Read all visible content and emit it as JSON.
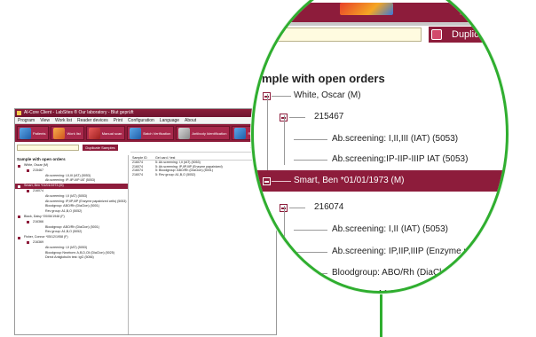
{
  "small_app": {
    "title": "Al-Core Client - LabSites ® Our laboratory - Blut geprüft",
    "menu": [
      "Program",
      "View",
      "Work list",
      "Reader devices",
      "Print",
      "Configuration",
      "Language",
      "About"
    ],
    "toolbar": [
      {
        "label": "Patients",
        "icon": "patients-icon",
        "color": "ico-blue"
      },
      {
        "label": "Work list",
        "icon": "worklist-icon",
        "color": "ico-orange"
      },
      {
        "label": "Manual scan",
        "icon": "manual-scan-icon",
        "color": "ico-red"
      },
      {
        "label": "Batch Verification",
        "icon": "batch-verification-icon",
        "color": "ico-blue"
      },
      {
        "label": "Antibody Identification",
        "icon": "antibody-id-icon",
        "color": "ico-grey"
      },
      {
        "label": "Results",
        "icon": "results-icon",
        "color": "ico-blue"
      }
    ],
    "duplicate_label": "Duplicate Samples",
    "right_header": "Smart, Ben",
    "left_heading": "Sample with open orders",
    "tree": [
      {
        "text": "White, Oscar (M)",
        "lvl": 0,
        "box": true
      },
      {
        "text": "215467",
        "lvl": 1,
        "box": true
      },
      {
        "text": "Ab.screening: I,II,III (IAT) (5053)",
        "lvl": 2
      },
      {
        "text": "Ab.screening: IP-IIP-IIIP IAT (5053)",
        "lvl": 2
      },
      {
        "text": "Smart, Ben *01/01/1973 (M)",
        "lvl": 0,
        "box": true,
        "sel": true
      },
      {
        "text": "216074",
        "lvl": 1,
        "box": true
      },
      {
        "text": "Ab.screening: I,II (IAT) (5053)",
        "lvl": 2
      },
      {
        "text": "Ab.screening: IP,IIP,IIIP (Enzyme papainized cells) (5053)",
        "lvl": 2
      },
      {
        "text": "Bloodgroup: ABO/Rh (DiaClon) (5001)",
        "lvl": 2
      },
      {
        "text": "Rev group: A1,B,O (5052)",
        "lvl": 2
      },
      {
        "text": "Black, Daisy *20/06/1948 (F)",
        "lvl": 0,
        "box": true
      },
      {
        "text": "216366",
        "lvl": 1,
        "box": true
      },
      {
        "text": "Bloodgroup: ABO/Rh (DiaClon) (5001)",
        "lvl": 2
      },
      {
        "text": "Rev group: A1,B,O (5052)",
        "lvl": 2
      },
      {
        "text": "Fisher, Connor *05/12/1958 (F)",
        "lvl": 0,
        "box": true
      },
      {
        "text": "216369",
        "lvl": 1,
        "box": true
      },
      {
        "text": "Ab.screening: I,II (IAT) (5053)",
        "lvl": 2
      },
      {
        "text": "Bloodgroup Newborn: A,B,D,Ctl (DiaClon) (5025)",
        "lvl": 2
      },
      {
        "text": "Direct Antiglobulin test: IgG (5056)",
        "lvl": 2
      }
    ],
    "results_columns": [
      "Sample ID",
      "Gel card / test"
    ],
    "results_rows": [
      [
        "216074",
        "5: Ab.screening: I,II (IAT) (5053)"
      ],
      [
        "216074",
        "5: Ab.screening: IP,IIP,IIIP (Enzyme papainized)"
      ],
      [
        "216074",
        "5: Bloodgroup: ABO/Rh (DiaClon) (5001)"
      ],
      [
        "216074",
        "5: Rev group: A1,B,O (5052)"
      ]
    ]
  },
  "zoom": {
    "duplicate_label": "Duplic",
    "heading": "mple with open orders",
    "rows": [
      {
        "text": "White, Oscar (M)",
        "kind": "patient"
      },
      {
        "text": "215467",
        "kind": "sample"
      },
      {
        "text": "Ab.screening: I,II,III (IAT) (5053)",
        "kind": "test"
      },
      {
        "text": "Ab.screening:IP-IIP-IIIP IAT (5053)",
        "kind": "test"
      },
      {
        "text": "Smart, Ben *01/01/1973 (M)",
        "kind": "patient",
        "selected": true
      },
      {
        "text": "216074",
        "kind": "sample"
      },
      {
        "text": "Ab.screening: I,II (IAT) (5053)",
        "kind": "test"
      },
      {
        "text": "Ab.screening: IP,IIP,IIIP (Enzyme papanized cel",
        "kind": "test"
      },
      {
        "text": "Bloodgroup: ABO/Rh (DiaClon) (5001)",
        "kind": "test"
      },
      {
        "text": "Rev group: A1,B,O (5052)",
        "kind": "test"
      }
    ]
  },
  "colors": {
    "brand": "#8d1c3b",
    "zoom_ring": "#2fae2f",
    "search_bg": "#fffbe0"
  }
}
